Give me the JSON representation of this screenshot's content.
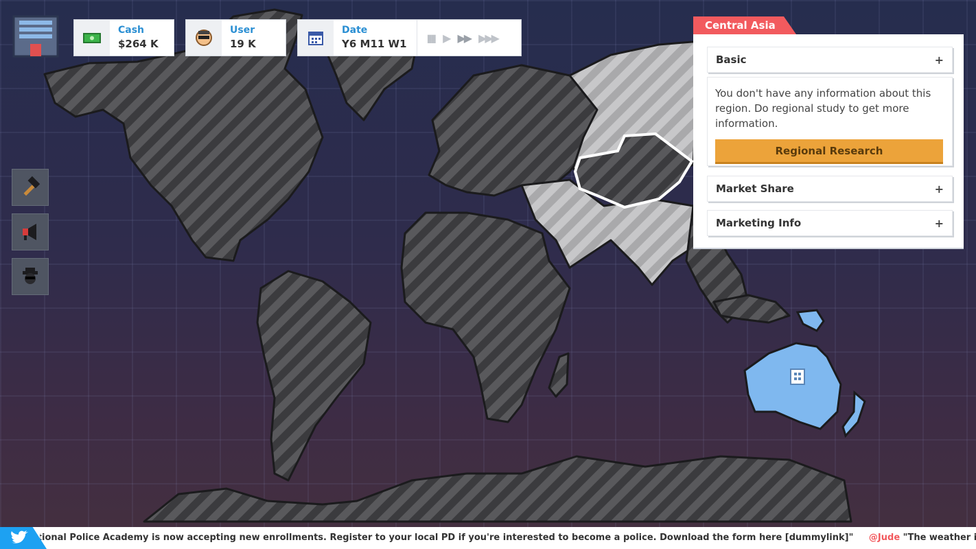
{
  "hud": {
    "cash": {
      "label": "Cash",
      "value": "$264 K"
    },
    "user": {
      "label": "User",
      "value": "19 K"
    },
    "date": {
      "label": "Date",
      "value": "Y6 M11 W1"
    }
  },
  "speed_controls": [
    "pause",
    "play",
    "fast",
    "fastest"
  ],
  "icons": {
    "hq": "building-icon",
    "cash": "money-icon",
    "user": "user-face-icon",
    "date": "calendar-icon",
    "tools": [
      "hammer-icon",
      "megaphone-icon",
      "spy-icon"
    ],
    "ticker": "twitter-bird-icon",
    "hq_marker": "building-marker-icon"
  },
  "region": {
    "name": "Central Asia",
    "sections": [
      {
        "title": "Basic",
        "toggle": "+"
      },
      {
        "title": "Market Share",
        "toggle": "+"
      },
      {
        "title": "Marketing Info",
        "toggle": "+"
      }
    ],
    "basic_text": "You don't have any information about this region. Do regional study to get more information.",
    "research_button": "Regional Research"
  },
  "ticker": {
    "message": "ational Police Academy is now accepting new enrollments. Register to your local PD if you're interested to become a police. Download the form here [dummylink]\"",
    "handle": "@Jude",
    "message2": "\"The weather is nice to go out"
  },
  "colors": {
    "accent_red": "#f25a5e",
    "button_orange": "#eca33a",
    "label_blue": "#2b8fd3",
    "owned_region": "#7fb8ef",
    "unknown_region": "#3a3a3e",
    "nearby_region": "#b9b9bb"
  }
}
